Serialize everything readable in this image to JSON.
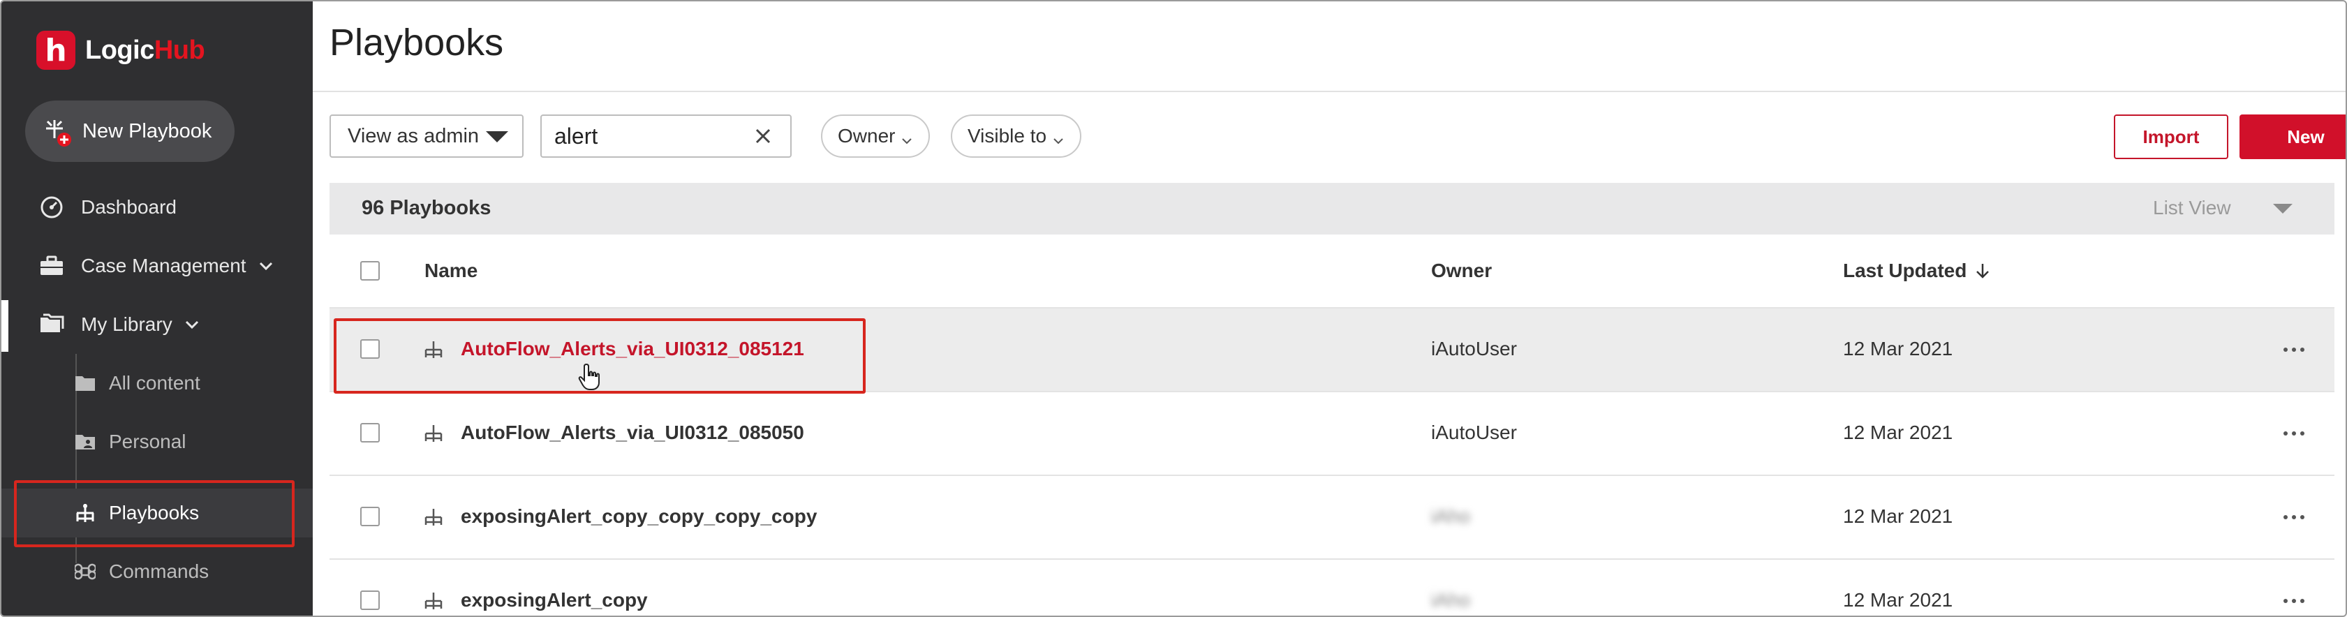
{
  "brand": {
    "logo_mark": "h",
    "name_part1": "Logic",
    "name_part2": "Hub"
  },
  "sidebar": {
    "new_button": "New Playbook",
    "items": [
      {
        "label": "Dashboard",
        "icon": "gauge-icon"
      },
      {
        "label": "Case Management",
        "icon": "briefcase-icon"
      },
      {
        "label": "My Library",
        "icon": "folders-icon"
      }
    ],
    "sub_items": [
      {
        "label": "All content",
        "icon": "folder-icon"
      },
      {
        "label": "Personal",
        "icon": "user-folder-icon"
      },
      {
        "label": "Playbooks",
        "icon": "playbook-icon"
      },
      {
        "label": "Commands",
        "icon": "command-icon"
      }
    ]
  },
  "page": {
    "title": "Playbooks"
  },
  "toolbar": {
    "view_select": "View as admin",
    "search_value": "alert",
    "filter_owner": "Owner",
    "filter_visible": "Visible to",
    "import_label": "Import",
    "new_label": "New"
  },
  "table": {
    "count": "96 Playbooks",
    "view_mode": "List View",
    "columns": {
      "name": "Name",
      "owner": "Owner",
      "updated": "Last Updated"
    },
    "rows": [
      {
        "name": "AutoFlow_Alerts_via_UI0312_085121",
        "owner": "iAutoUser",
        "updated": "12 Mar 2021"
      },
      {
        "name": "AutoFlow_Alerts_via_UI0312_085050",
        "owner": "iAutoUser",
        "updated": "12 Mar 2021"
      },
      {
        "name": "exposingAlert_copy_copy_copy_copy",
        "owner": "iAho",
        "updated": "12 Mar 2021"
      },
      {
        "name": "exposingAlert_copy",
        "owner": "iAho",
        "updated": "12 Mar 2021"
      }
    ]
  },
  "colors": {
    "brand_red": "#d1102a",
    "sidebar_bg": "#2f2f31",
    "highlight": "#d7261e"
  }
}
